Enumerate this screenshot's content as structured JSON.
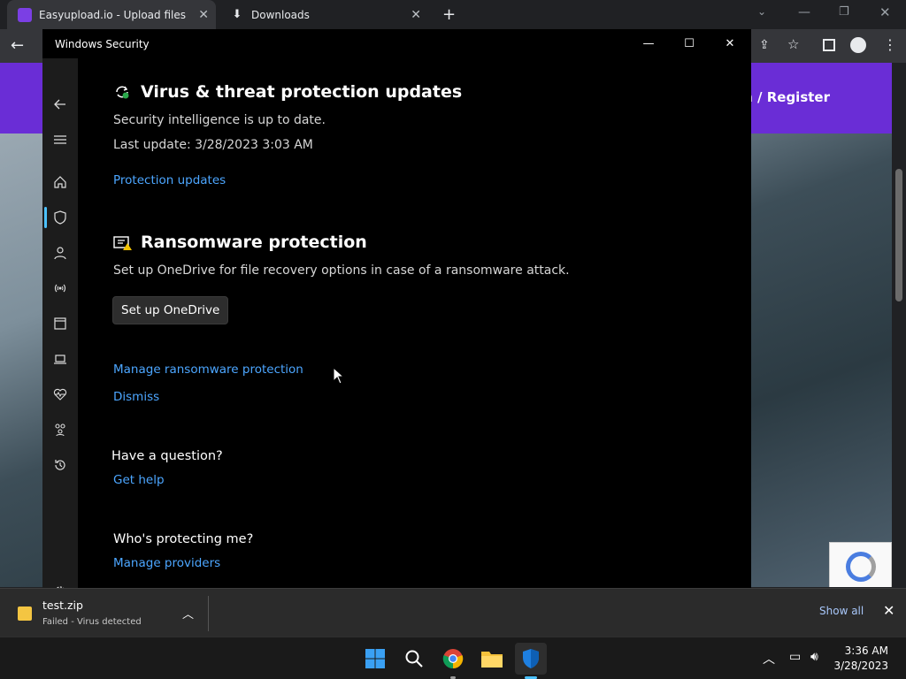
{
  "browser": {
    "tabs": [
      {
        "label": "Easyupload.io - Upload files for free"
      },
      {
        "label": "Downloads"
      }
    ],
    "new_tab": "+",
    "site": {
      "login_label": "Login / Register"
    }
  },
  "window": {
    "title": "Windows Security",
    "controls": {
      "minimize": "—",
      "maximize": "☐",
      "close": "✕"
    }
  },
  "nav": {
    "items": [
      "back-icon",
      "menu-icon",
      "home-icon",
      "shield-icon",
      "account-icon",
      "firewall-icon",
      "app-browser-icon",
      "device-security-icon",
      "device-health-icon",
      "family-icon",
      "history-icon",
      "settings-icon"
    ]
  },
  "content": {
    "updates": {
      "title": "Virus & threat protection updates",
      "status": "Security intelligence is up to date.",
      "last_update": "Last update: 3/28/2023 3:03 AM",
      "link": "Protection updates"
    },
    "ransomware": {
      "title": "Ransomware protection",
      "description": "Set up OneDrive for file recovery options in case of a ransomware attack.",
      "button": "Set up OneDrive",
      "manage_link": "Manage ransomware protection",
      "dismiss_link": "Dismiss"
    },
    "question": {
      "title": "Have a question?",
      "link": "Get help"
    },
    "protecting": {
      "title": "Who's protecting me?",
      "link": "Manage providers"
    }
  },
  "download": {
    "filename": "test.zip",
    "status": "Failed - Virus detected",
    "show_all": "Show all",
    "close": "✕"
  },
  "taskbar": {
    "time": "3:36 AM",
    "date": "3/28/2023"
  },
  "colors": {
    "accent": "#4ca6ff",
    "brand": "#6a2dd6"
  }
}
